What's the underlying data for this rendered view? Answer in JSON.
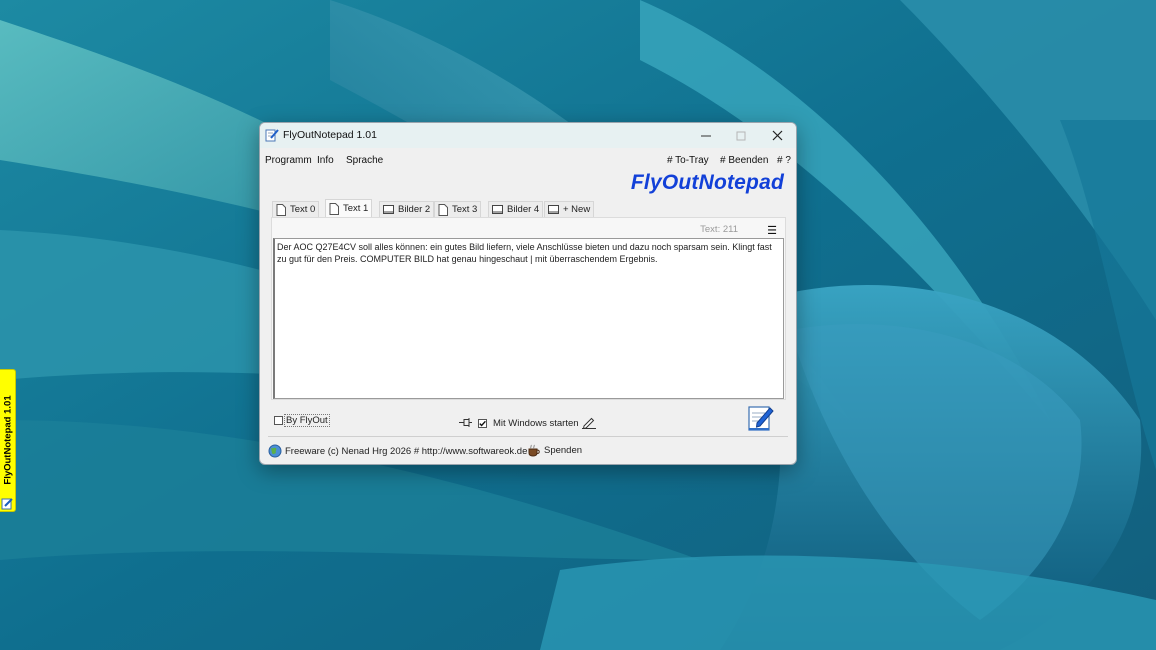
{
  "window": {
    "title": "FlyOutNotepad 1.01",
    "brand": "FlyOutNotepad"
  },
  "side_tab": {
    "label": "FlyOutNotepad 1.01"
  },
  "menu": {
    "left": [
      "Programm",
      "Info",
      "Sprache"
    ],
    "right": [
      "# To-Tray",
      "# Beenden",
      "# ?"
    ]
  },
  "tabs": [
    {
      "label": "Text 0",
      "icon": "document-icon",
      "active": false
    },
    {
      "label": "Text 1",
      "icon": "document-icon",
      "active": true
    },
    {
      "label": "Bilder 2",
      "icon": "image-icon",
      "active": false
    },
    {
      "label": "Text 3",
      "icon": "document-icon",
      "active": false
    },
    {
      "label": "Bilder 4",
      "icon": "image-icon",
      "active": false
    },
    {
      "label": "+ New",
      "icon": "image-icon",
      "active": false
    }
  ],
  "editor": {
    "count": "Text: 211",
    "content": "Der AOC Q27E4CV soll alles können: ein gutes Bild liefern, viele Anschlüsse bieten und dazu noch sparsam sein. Klingt fast zu gut für den Preis. COMPUTER BILD hat genau hingeschaut | mit überraschendem Ergebnis."
  },
  "options": {
    "by_flyout": "By FlyOut",
    "by_flyout_checked": false,
    "windows_start": "Mit Windows starten",
    "windows_start_checked": true
  },
  "footer": {
    "copyright": "Freeware (c) Nenad Hrg 2026 # http://www.softwareok.de",
    "donate": "Spenden"
  },
  "colors": {
    "brand": "#1240d8",
    "side_tab": "#ffff00"
  }
}
